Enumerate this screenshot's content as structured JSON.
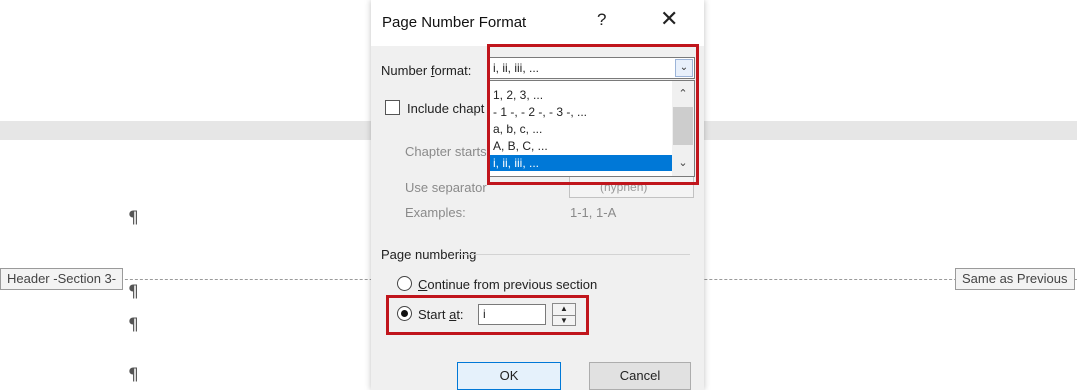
{
  "document": {
    "pilcrow": "¶",
    "header_label": "Header -Section 3-",
    "same_as_previous": "Same as Previous"
  },
  "dialog": {
    "title": "Page Number Format",
    "help_label": "?",
    "close_label": "✕",
    "number_format": {
      "label_pre": "Number ",
      "label_key": "f",
      "label_post": "ormat:",
      "value": "i, ii, iii, ...",
      "options": [
        "1, 2, 3, ...",
        "- 1 -, - 2 -, - 3 -, ...",
        "a, b, c, ...",
        "A, B, C, ...",
        "i, ii, iii, ..."
      ],
      "selected_index": 4
    },
    "include_chapter_label": "Include chapt",
    "chapter_starts_label": "Chapter starts",
    "use_separator_label": "Use separator",
    "separator_value": "(hyphen)",
    "examples_label": "Examples:",
    "examples_value": "1-1, 1-A",
    "page_numbering": {
      "group_label": "Page numbering",
      "continue": {
        "key": "C",
        "rest": "ontinue from previous section"
      },
      "start_at": {
        "pre": "Start ",
        "key": "a",
        "post": "t:",
        "value": "i"
      }
    },
    "buttons": {
      "ok": "OK",
      "cancel": "Cancel"
    }
  },
  "colors": {
    "highlight_box": "#c0151c",
    "selection": "#0078d7"
  }
}
